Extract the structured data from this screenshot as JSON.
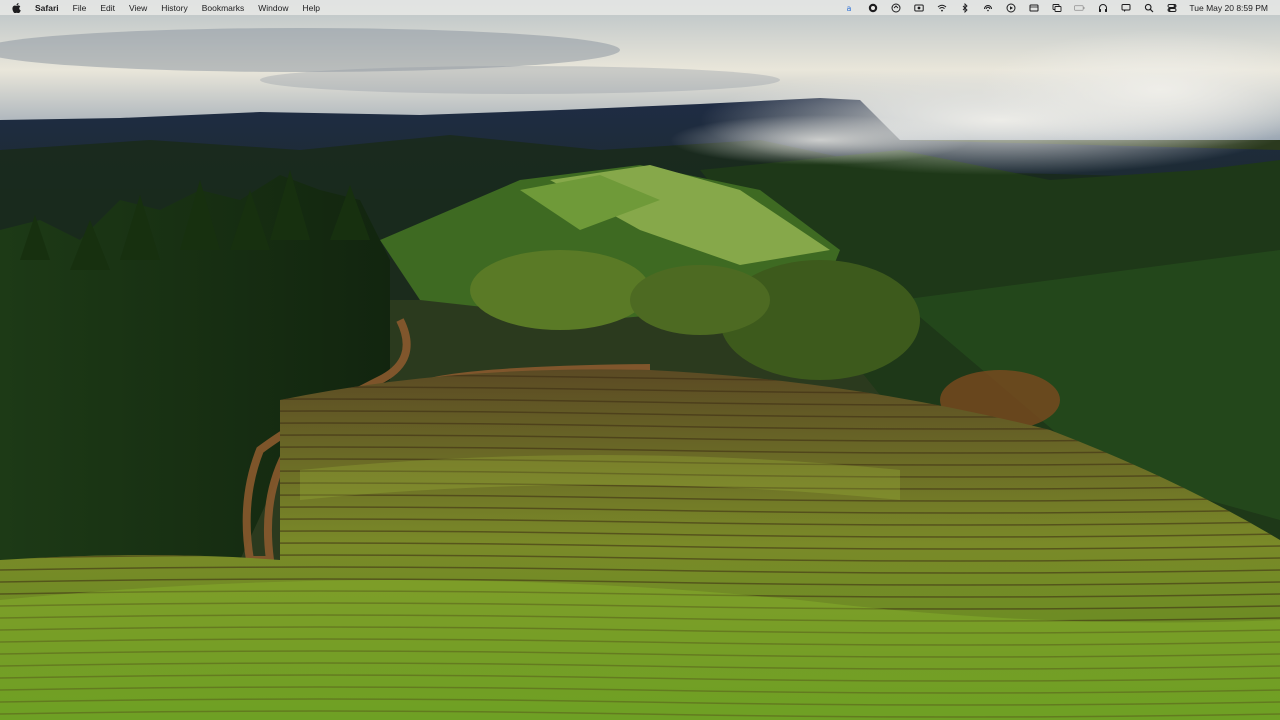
{
  "menubar": {
    "apple_icon": "apple-logo-icon",
    "app_name": "Safari",
    "menus": [
      "File",
      "Edit",
      "View",
      "History",
      "Bookmarks",
      "Window",
      "Help"
    ],
    "status_icons": [
      "text-input-icon",
      "vpn-globe-icon",
      "sync-icon",
      "screen-record-icon",
      "wifi-icon",
      "bluetooth-icon",
      "airdrop-icon",
      "play-icon",
      "window-icon",
      "display-icon",
      "battery-icon",
      "headphones-icon",
      "chat-icon",
      "search-icon",
      "control-center-icon"
    ],
    "clock": "Tue May 20  8:59 PM"
  },
  "wallpaper": {
    "description_icon": "vineyard-landscape-wallpaper"
  }
}
